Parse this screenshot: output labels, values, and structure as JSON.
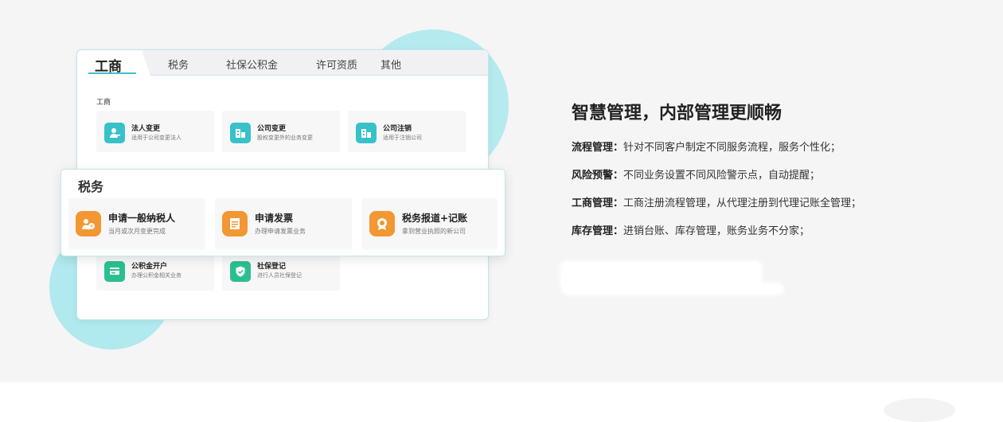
{
  "colors": {
    "accent": "#42c0cc",
    "teal": "#38c1c9",
    "green": "#2bbf8f",
    "orange": "#f39732"
  },
  "tabs": [
    {
      "label": "工商",
      "active": true
    },
    {
      "label": "税务",
      "active": false
    },
    {
      "label": "社保公积金",
      "active": false
    },
    {
      "label": "许可资质",
      "active": false
    },
    {
      "label": "其他",
      "active": false
    }
  ],
  "gongshang": {
    "label": "工商",
    "cards": [
      {
        "title": "法人变更",
        "sub": "适用于公司变更法人",
        "icon": "person-icon"
      },
      {
        "title": "公司变更",
        "sub": "股权变更外的业务变更",
        "icon": "building-icon"
      },
      {
        "title": "公司注销",
        "sub": "适用于注销公司",
        "icon": "building-icon"
      }
    ]
  },
  "shebao": {
    "cards": [
      {
        "title": "公积金开户",
        "sub": "办理公积金相关业务",
        "icon": "card-icon"
      },
      {
        "title": "社保登记",
        "sub": "进行人员社保登记",
        "icon": "shield-icon"
      }
    ]
  },
  "shuiwu": {
    "label": "税务",
    "cards": [
      {
        "title": "申请一般纳税人",
        "sub": "当月或次月变更完成",
        "icon": "coin-person-icon"
      },
      {
        "title": "申请发票",
        "sub": "办理申请发票业务",
        "icon": "invoice-icon"
      },
      {
        "title": "税务报道+记账",
        "sub": "拿到营业执照的新公司",
        "icon": "badge-icon"
      }
    ]
  },
  "right": {
    "heading": "智慧管理，内部管理更顺畅",
    "features": [
      {
        "label": "流程管理：",
        "text": "针对不同客户制定不同服务流程，服务个性化；"
      },
      {
        "label": "风险预警：",
        "text": "不同业务设置不同风险警示点，自动提醒；"
      },
      {
        "label": "工商管理：",
        "text": "工商注册流程管理，从代理注册到代理记账全管理；"
      },
      {
        "label": "库存管理：",
        "text": "进销台账、库存管理，账务业务不分家；"
      }
    ]
  }
}
